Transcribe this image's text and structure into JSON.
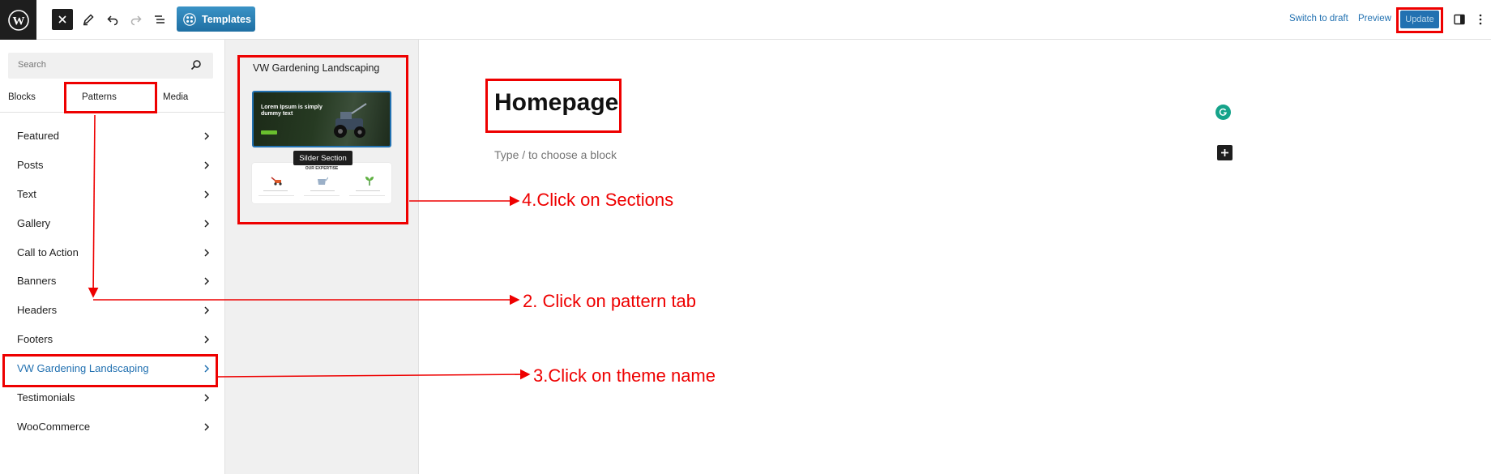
{
  "toolbar": {
    "templates_label": "Templates",
    "switch_to_draft": "Switch to draft",
    "preview": "Preview",
    "update": "Update"
  },
  "inserter": {
    "search_placeholder": "Search",
    "tabs": [
      "Blocks",
      "Patterns",
      "Media"
    ],
    "categories": [
      "Featured",
      "Posts",
      "Text",
      "Gallery",
      "Call to Action",
      "Banners",
      "Headers",
      "Footers",
      "VW Gardening Landscaping",
      "Testimonials",
      "WooCommerce"
    ],
    "active_category": "VW Gardening Landscaping"
  },
  "patterns_panel": {
    "title": "VW Gardening Landscaping",
    "preview1_text": "Lorem Ipsum is simply dummy text",
    "tooltip": "Silder Section",
    "preview2_heading": "OUR EXPERTISE"
  },
  "editor": {
    "page_title": "Homepage",
    "block_placeholder": "Type / to choose a block"
  },
  "annotations": {
    "step2": "2. Click on pattern tab",
    "step3": "3.Click on theme name",
    "step4": "4.Click on Sections"
  },
  "colors": {
    "annotation_red": "#ee0000",
    "wp_blue": "#2271b1",
    "dark": "#1e1e1e"
  }
}
